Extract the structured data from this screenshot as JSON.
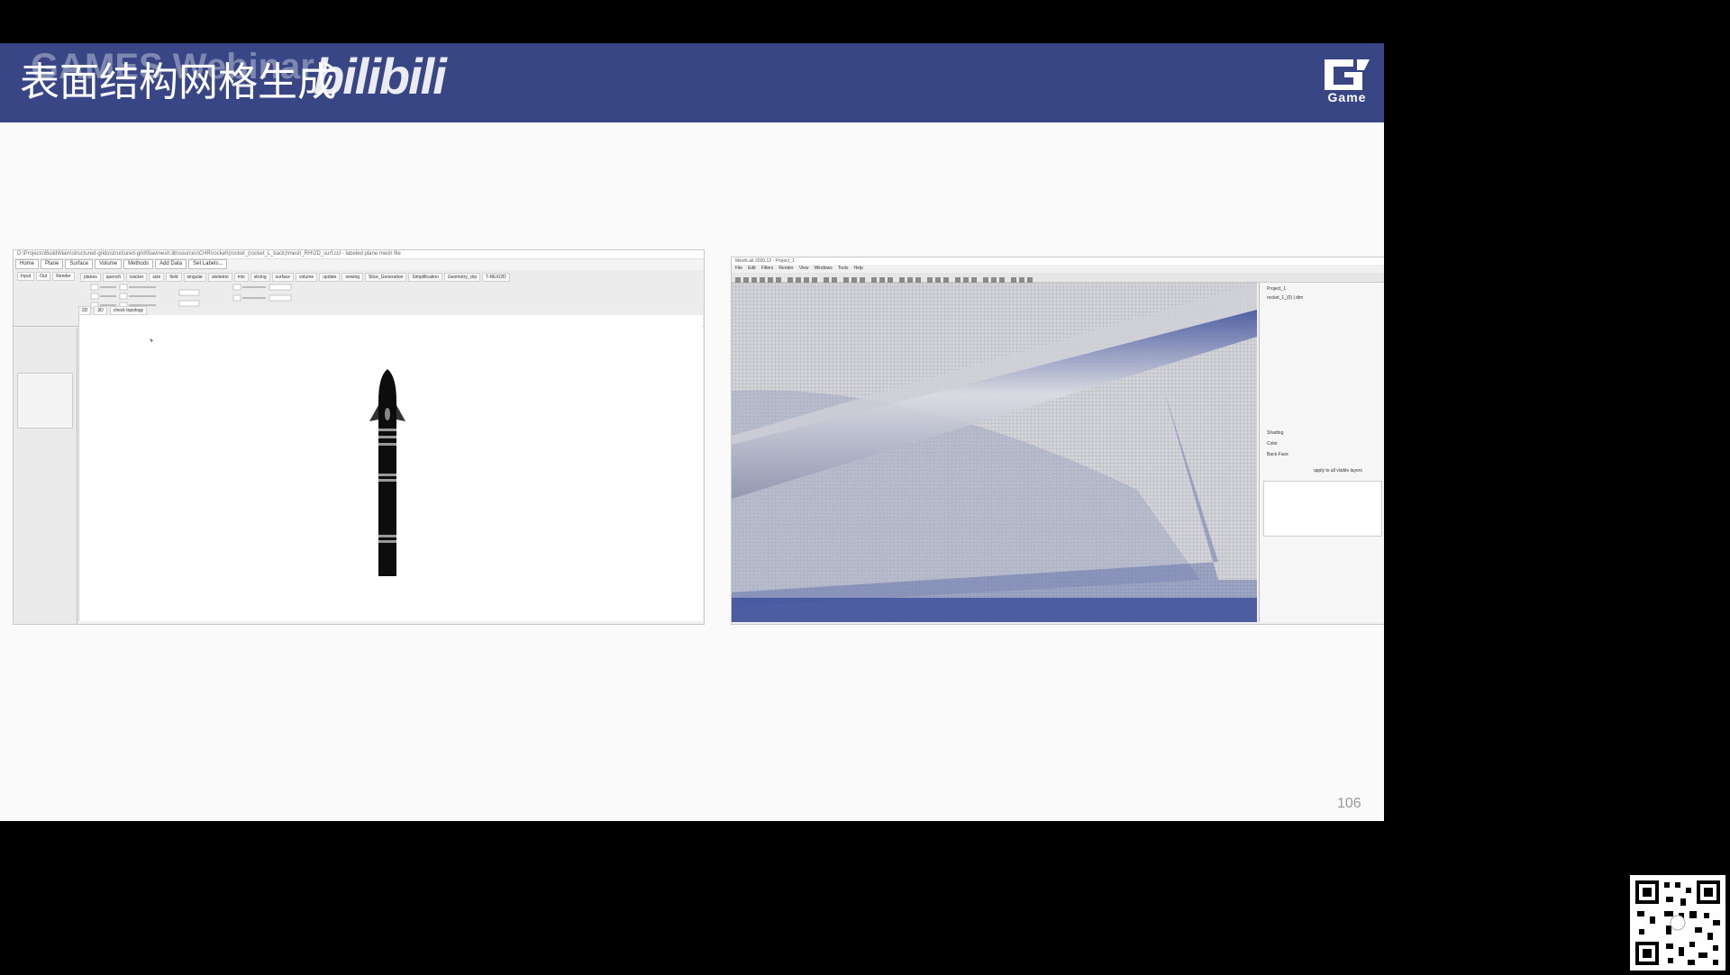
{
  "slide": {
    "banner_ghost": "GAMES Webinar",
    "title": "表面结构网格生成",
    "watermark": "bilibili",
    "logo_text": "Game",
    "page_number": "106"
  },
  "left_app": {
    "title_bar": "D:\\Projects\\Build\\Main\\structured-grids\\structured-grid\\Navmesh.lib\\sources\\CHR\\rocket\\(rocket_(rocket_L_back)\\mesh_RH\\2D_surf.ccl - labeled plane mesh file",
    "ribbon_tabs": [
      "Home",
      "Plane",
      "Surface",
      "Volume",
      "Methods",
      "Add Data",
      "Set Labels..."
    ],
    "ribbon_buttons": [
      "planes",
      "quench",
      "tracker",
      "size",
      "field",
      "singular",
      "skeleton",
      "mtx",
      "slicing",
      "surface",
      "volume",
      "update",
      "sewing",
      "Slice_Generation",
      "Simplification",
      "Geometry_clip",
      "T-REX/2D"
    ],
    "left_tabs": [
      "Input",
      "Out",
      "Render"
    ],
    "doc_tabs": [
      "2D",
      "3D",
      "check topology"
    ]
  },
  "right_app": {
    "title_bar": "MeshLab 2020.12 - Project_1",
    "menu": [
      "File",
      "Edit",
      "Filters",
      "Render",
      "View",
      "Windows",
      "Tools",
      "Help"
    ],
    "side_labels": [
      "Project_1",
      "rocket_1_(0) | dim",
      "Shading",
      "Color",
      "Back-Face",
      "apply to all visible layers"
    ]
  },
  "colors": {
    "banner": "#384685",
    "mesh_blue": "#3a4c9a"
  }
}
